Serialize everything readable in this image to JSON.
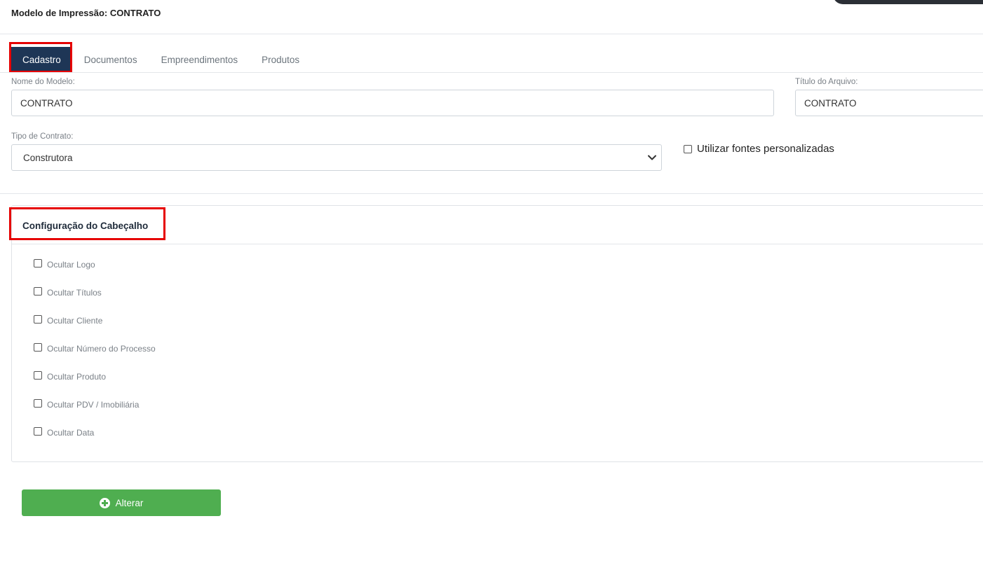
{
  "header": {
    "title": "Modelo de Impressão: CONTRATO"
  },
  "tabs": [
    {
      "label": "Cadastro",
      "active": true
    },
    {
      "label": "Documentos",
      "active": false
    },
    {
      "label": "Empreendimentos",
      "active": false
    },
    {
      "label": "Produtos",
      "active": false
    }
  ],
  "form": {
    "nome_label": "Nome do Modelo:",
    "nome_value": "CONTRATO",
    "titulo_label": "Título do Arquivo:",
    "titulo_value": "CONTRATO",
    "tipo_label": "Tipo de Contrato:",
    "tipo_value": "Construtora",
    "fontes_label": "Utilizar fontes personalizadas",
    "fontes_checked": false
  },
  "header_config": {
    "title": "Configuração do Cabeçalho",
    "options": [
      {
        "label": "Ocultar Logo",
        "checked": false
      },
      {
        "label": "Ocultar Títulos",
        "checked": false
      },
      {
        "label": "Ocultar Cliente",
        "checked": false
      },
      {
        "label": "Ocultar Número do Processo",
        "checked": false
      },
      {
        "label": "Ocultar Produto",
        "checked": false
      },
      {
        "label": "Ocultar PDV / Imobiliária",
        "checked": false
      },
      {
        "label": "Ocultar Data",
        "checked": false
      }
    ]
  },
  "actions": {
    "submit_label": "Alterar"
  },
  "colors": {
    "tab_active_bg": "#1e3656",
    "button_green": "#4fae50",
    "highlight_red": "#e60000"
  }
}
